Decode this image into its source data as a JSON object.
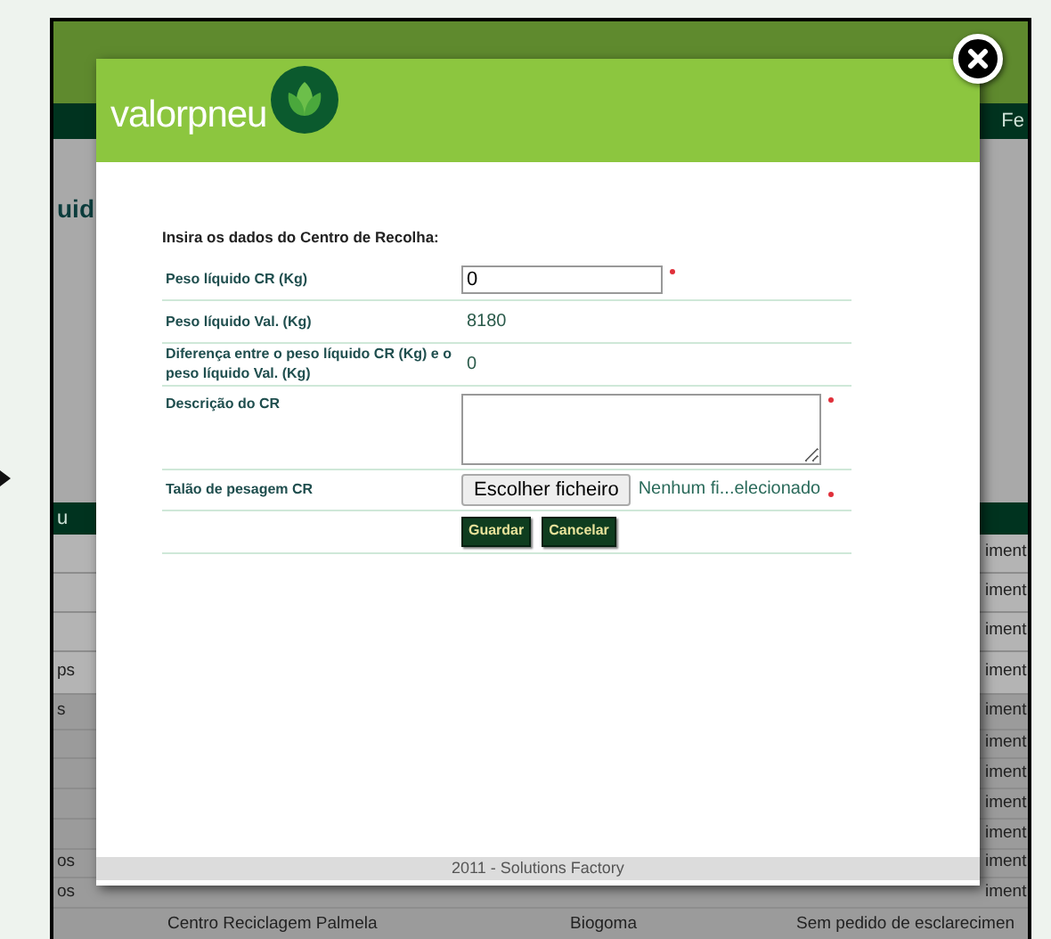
{
  "background_page": {
    "header_fragment": "Fe",
    "heading_fragment": "uid",
    "table_header_fragment": "u",
    "rows": [
      {
        "column_4": "iment"
      },
      {
        "column_4": "iment"
      },
      {
        "column_4": "iment"
      },
      {
        "column_1": "ps",
        "column_4": "iment"
      },
      {
        "column_1": "s",
        "column_4": "iment"
      },
      {
        "column_4": "iment"
      },
      {
        "column_4": "iment"
      },
      {
        "column_4": "iment"
      },
      {
        "column_4": "iment"
      },
      {
        "column_1": "os",
        "column_4": "iment"
      },
      {
        "column_1": "os",
        "column_4": "iment"
      },
      {
        "column_2": "Centro Reciclagem Palmela",
        "column_3": "Biogoma",
        "column_4": "Sem pedido de esclarecimen"
      }
    ]
  },
  "modal": {
    "logo_text": "valorpneu",
    "form_title": "Insira os dados do Centro de Recolha:",
    "fields": [
      {
        "kind": "input",
        "label": "Peso líquido CR (Kg)",
        "value": "0",
        "required": true
      },
      {
        "kind": "text",
        "label": "Peso líquido Val. (Kg)",
        "value": "8180",
        "required": false
      },
      {
        "kind": "text",
        "label": "Diferença entre o peso líquido CR (Kg) e o peso líquido Val. (Kg)",
        "value": "0",
        "required": false
      },
      {
        "kind": "textarea",
        "label": "Descrição do CR",
        "required": true
      },
      {
        "kind": "file",
        "label": "Talão de pesagem CR",
        "button": "Escolher ficheiro",
        "status": "Nenhum fi...elecionado",
        "required": true
      }
    ],
    "actions": [
      "Guardar",
      "Cancelar"
    ],
    "footer": "2011 - Solutions Factory"
  }
}
